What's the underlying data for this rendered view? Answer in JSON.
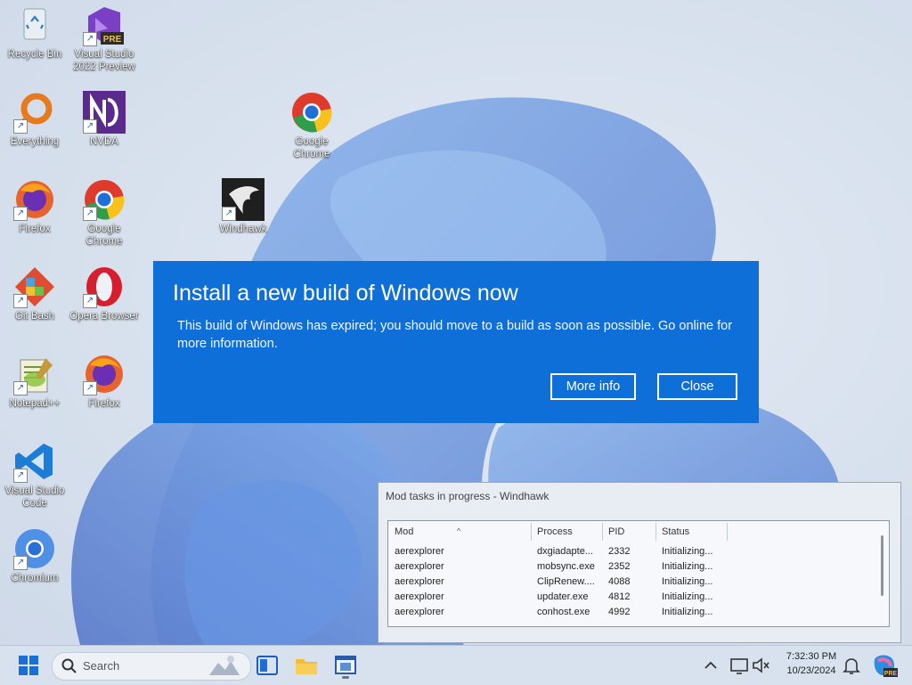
{
  "desktop": {
    "icons": [
      {
        "label": "Recycle Bin"
      },
      {
        "label": "Visual Studio 2022 Preview",
        "badge": "PRE"
      },
      {
        "label": "Everything"
      },
      {
        "label": "NVDA"
      },
      {
        "label": "Google Chrome"
      },
      {
        "label": "Firefox"
      },
      {
        "label": "Google Chrome"
      },
      {
        "label": "Windhawk"
      },
      {
        "label": "Git Bash"
      },
      {
        "label": "Opera Browser"
      },
      {
        "label": "Notepad++"
      },
      {
        "label": "Firefox"
      },
      {
        "label": "Visual Studio Code"
      },
      {
        "label": "Chromium"
      }
    ]
  },
  "dialog": {
    "title": "Install a new build of Windows now",
    "message": "This build of Windows has expired; you should move to a build as soon as possible. Go online for more information.",
    "more_info_label": "More info",
    "close_label": "Close",
    "color": "#0f6fd9"
  },
  "mod_tasks": {
    "title": "Mod tasks in progress - Windhawk",
    "columns": [
      "Mod",
      "Process",
      "PID",
      "Status"
    ],
    "rows": [
      {
        "mod": "aerexplorer",
        "process": "dxgiadapte...",
        "pid": "2332",
        "status": "Initializing..."
      },
      {
        "mod": "aerexplorer",
        "process": "mobsync.exe",
        "pid": "2352",
        "status": "Initializing..."
      },
      {
        "mod": "aerexplorer",
        "process": "ClipRenew....",
        "pid": "4088",
        "status": "Initializing..."
      },
      {
        "mod": "aerexplorer",
        "process": "updater.exe",
        "pid": "4812",
        "status": "Initializing..."
      },
      {
        "mod": "aerexplorer",
        "process": "conhost.exe",
        "pid": "4992",
        "status": "Initializing..."
      }
    ]
  },
  "taskbar": {
    "search_placeholder": "Search",
    "time": "7:32:30 PM",
    "date": "10/23/2024",
    "icons": [
      "start-icon",
      "search-icon",
      "task-view-icon",
      "file-explorer-icon",
      "app-window-icon",
      "chevron-up-icon",
      "network-icon",
      "volume-icon",
      "notification-bell-icon",
      "copilot-icon"
    ],
    "copilot_badge": "PRE"
  }
}
